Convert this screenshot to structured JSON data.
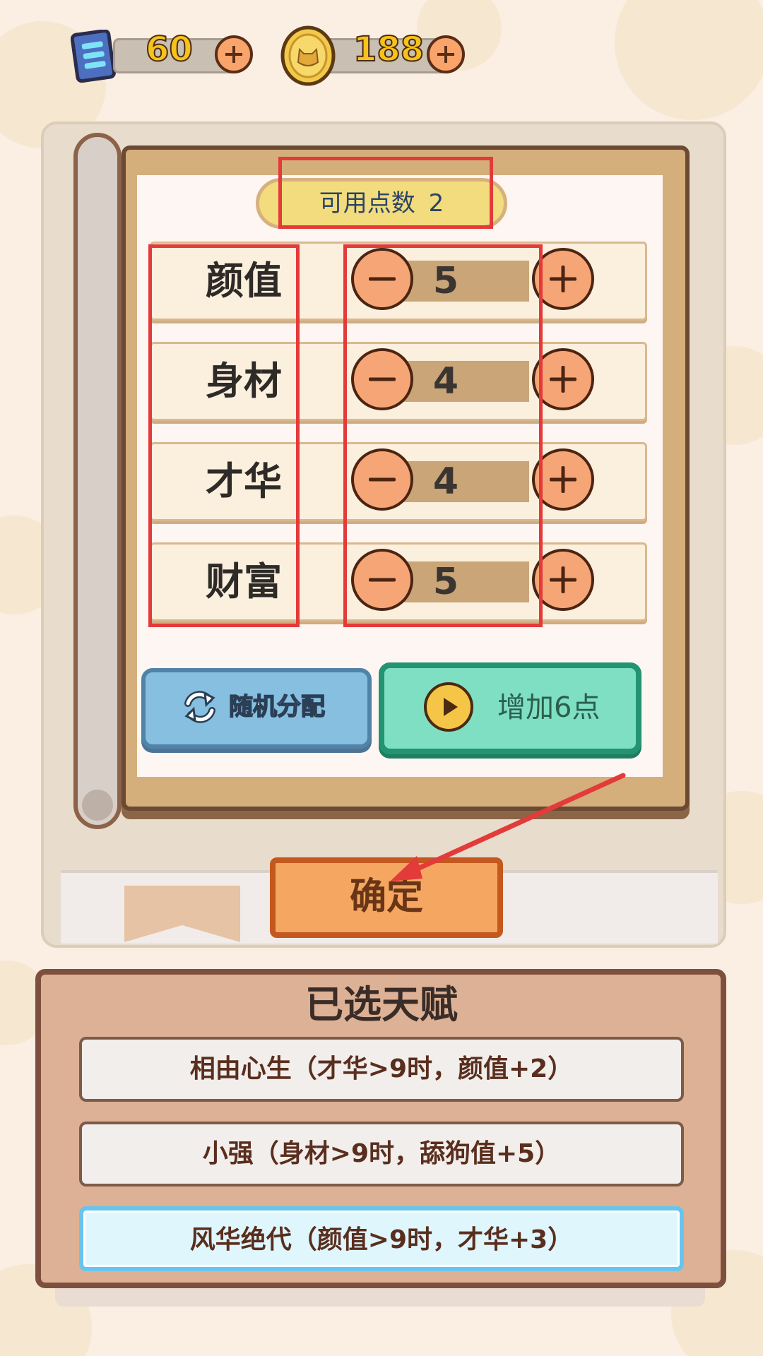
{
  "resources": {
    "energy": {
      "icon": "energy-card-icon",
      "value": "60"
    },
    "coins": {
      "icon": "doge-coin-icon",
      "value": "188"
    }
  },
  "points_panel": {
    "label": "可用点数",
    "available": "2"
  },
  "stats": [
    {
      "label": "颜值",
      "value": 5
    },
    {
      "label": "身材",
      "value": 4
    },
    {
      "label": "才华",
      "value": 4
    },
    {
      "label": "财富",
      "value": 5
    }
  ],
  "buttons": {
    "random": "随机分配",
    "add_points": "增加6点",
    "confirm": "确定"
  },
  "talents": {
    "title": "已选天赋",
    "items": [
      {
        "text": "相由心生（才华>9时，颜值+2）",
        "selected": false
      },
      {
        "text": "小强（身材>9时，舔狗值+5）",
        "selected": false
      },
      {
        "text": "风华绝代（颜值>9时，才华+3）",
        "selected": true
      }
    ]
  },
  "colors": {
    "background": "#fbeee3",
    "annotation": "#e33a3a",
    "confirm": "#f5a761",
    "random": "#86bfe0",
    "add": "#7fdfc3",
    "selected_talent": "#dff6fd"
  }
}
